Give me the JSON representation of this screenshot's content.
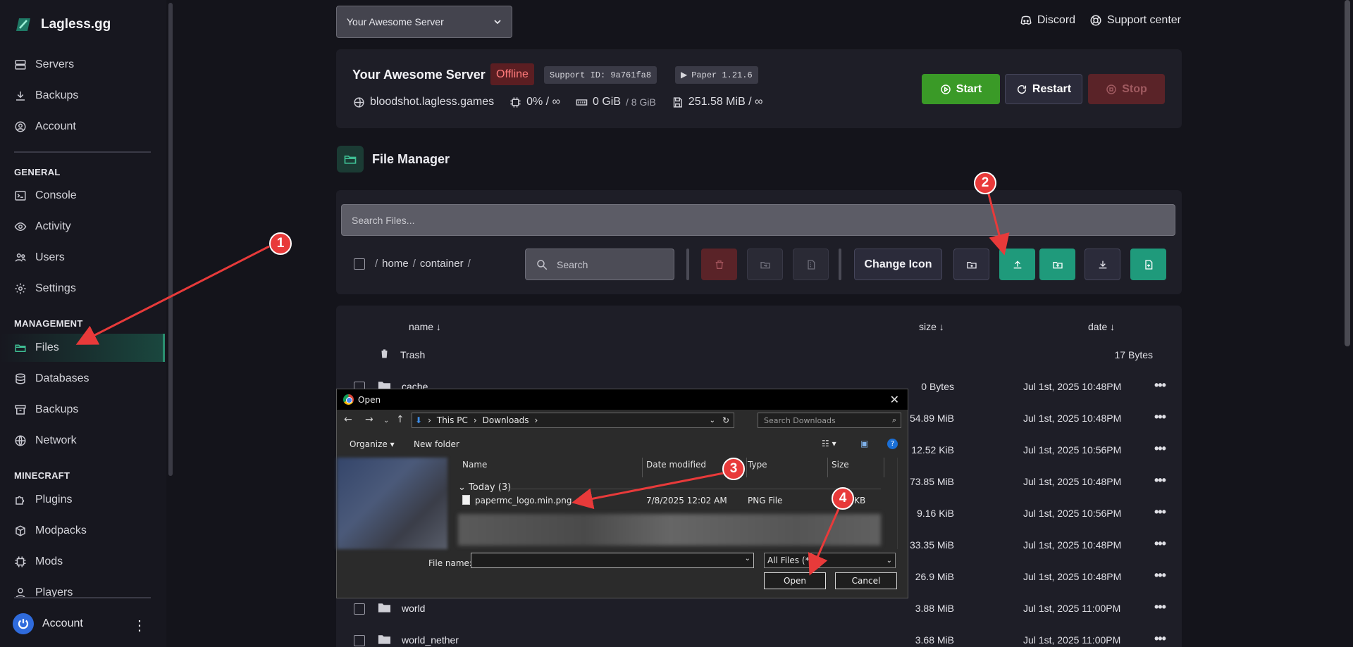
{
  "brand": {
    "name": "Lagless.gg"
  },
  "sidebar": {
    "top_items": [
      {
        "label": "Servers",
        "icon": "server-icon"
      },
      {
        "label": "Backups",
        "icon": "download-icon"
      },
      {
        "label": "Account",
        "icon": "user-circle-icon"
      }
    ],
    "sections": {
      "general": "GENERAL",
      "management": "MANAGEMENT",
      "minecraft": "MINECRAFT"
    },
    "general_items": [
      {
        "label": "Console",
        "icon": "terminal-icon"
      },
      {
        "label": "Activity",
        "icon": "eye-icon"
      },
      {
        "label": "Users",
        "icon": "users-icon"
      },
      {
        "label": "Settings",
        "icon": "gear-icon"
      }
    ],
    "management_items": [
      {
        "label": "Files",
        "icon": "folder-open-icon",
        "active": true
      },
      {
        "label": "Databases",
        "icon": "database-icon"
      },
      {
        "label": "Backups",
        "icon": "archive-icon"
      },
      {
        "label": "Network",
        "icon": "globe-icon"
      }
    ],
    "minecraft_items": [
      {
        "label": "Plugins",
        "icon": "puzzle-icon"
      },
      {
        "label": "Modpacks",
        "icon": "box-icon"
      },
      {
        "label": "Mods",
        "icon": "chip-icon"
      },
      {
        "label": "Players",
        "icon": "user-icon"
      }
    ],
    "footer": {
      "label": "Account"
    }
  },
  "header": {
    "server_select": "Your Awesome Server",
    "discord": "Discord",
    "support": "Support center"
  },
  "server": {
    "name": "Your Awesome Server",
    "status": "Offline",
    "support_id": "Support ID: 9a761fa8",
    "software": "Paper 1.21.6",
    "address": "bloodshot.lagless.games",
    "cpu": "0% / ∞",
    "memory": "0 GiB",
    "memory_limit": "/ 8 GiB",
    "disk": "251.58 MiB / ∞",
    "start": "Start",
    "restart": "Restart",
    "stop": "Stop"
  },
  "file_manager": {
    "title": "File Manager",
    "search_placeholder": "Search Files...",
    "path_home": "home",
    "path_container": "container",
    "toolbar_search": "Search",
    "change_icon": "Change Icon",
    "columns": {
      "name": "name ↓",
      "size": "size ↓",
      "date": "date ↓"
    },
    "trash": {
      "name": "Trash",
      "size": "17 Bytes"
    },
    "rows": [
      {
        "name": "cache",
        "size": "0 Bytes",
        "date": "Jul 1st, 2025 10:48PM"
      },
      {
        "name": "",
        "size": "54.89 MiB",
        "date": "Jul 1st, 2025 10:48PM"
      },
      {
        "name": "",
        "size": "12.52 KiB",
        "date": "Jul 1st, 2025 10:56PM"
      },
      {
        "name": "",
        "size": "73.85 MiB",
        "date": "Jul 1st, 2025 10:48PM"
      },
      {
        "name": "",
        "size": "9.16 KiB",
        "date": "Jul 1st, 2025 10:56PM"
      },
      {
        "name": "",
        "size": "33.35 MiB",
        "date": "Jul 1st, 2025 10:48PM"
      },
      {
        "name": "",
        "size": "26.9 MiB",
        "date": "Jul 1st, 2025 10:48PM"
      },
      {
        "name": "world",
        "size": "3.88 MiB",
        "date": "Jul 1st, 2025 11:00PM"
      },
      {
        "name": "world_nether",
        "size": "3.68 MiB",
        "date": "Jul 1st, 2025 11:00PM"
      }
    ]
  },
  "dialog": {
    "title": "Open",
    "breadcrumb": [
      "This PC",
      "Downloads"
    ],
    "search_placeholder": "Search Downloads",
    "organize": "Organize",
    "new_folder": "New folder",
    "columns": [
      "Name",
      "Date modified",
      "Type",
      "Size"
    ],
    "group": "Today (3)",
    "file": {
      "name": "papermc_logo.min.png",
      "date": "7/8/2025 12:02 AM",
      "type": "PNG File",
      "size": "70 KB"
    },
    "file_name_label": "File name:",
    "file_type": "All Files (*.*)",
    "open": "Open",
    "cancel": "Cancel"
  },
  "annotations": [
    "1",
    "2",
    "3",
    "4"
  ],
  "colors": {
    "accent": "#1f9a7b",
    "start": "#3a9a27",
    "stop": "#5a2328",
    "annotation": "#e83a3a"
  }
}
